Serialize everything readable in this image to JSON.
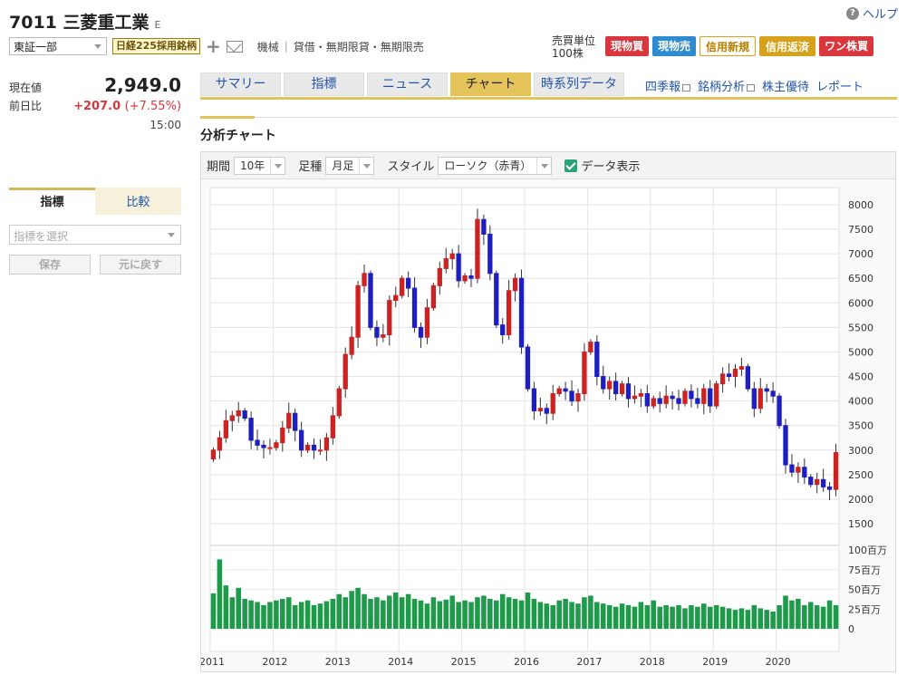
{
  "header": {
    "code_name": "7011 三菱重工業",
    "market_flag": "E",
    "help": "ヘルプ",
    "market_select": "東証一部",
    "nikkei_badge": "日経225採用銘柄",
    "industry": "機械",
    "margin_info": "貸借・無期限貸・無期限売",
    "unit_label": "売買単位",
    "unit_value": "100株"
  },
  "trade_buttons": [
    "現物買",
    "現物売",
    "信用新規",
    "信用返済",
    "ワン株買"
  ],
  "quote": {
    "price_label": "現在値",
    "price": "2,949.0",
    "change_label": "前日比",
    "change": "+207.0",
    "change_pct": "(+7.55%)",
    "time": "15:00"
  },
  "side": {
    "tab_indicator": "指標",
    "tab_compare": "比較",
    "indicator_placeholder": "指標を選択",
    "save": "保存",
    "reset": "元に戻す"
  },
  "tabs": [
    "サマリー",
    "指標",
    "ニュース",
    "チャート",
    "時系列データ"
  ],
  "tab_links": [
    "四季報",
    "銘柄分析",
    "株主優待",
    "レポート"
  ],
  "section_title": "分析チャート",
  "controls": {
    "period_label": "期間",
    "period_value": "10年",
    "bar_label": "足種",
    "bar_value": "月足",
    "style_label": "スタイル",
    "style_value": "ローソク（赤青）",
    "data_label": "データ表示"
  },
  "colors": {
    "up": "#cc2222",
    "down": "#1f1fbf",
    "volume": "#1e9a4a",
    "accent": "#e4c45a"
  },
  "chart_data": {
    "type": "candlestick",
    "interval": "monthly",
    "price_ticks": [
      1500,
      2000,
      2500,
      3000,
      3500,
      4000,
      4500,
      5000,
      5500,
      6000,
      6500,
      7000,
      7500,
      8000
    ],
    "volume_ticks": [
      "0",
      "25百万",
      "50百万",
      "75百万",
      "100百万"
    ],
    "volume_ylim": [
      0,
      100
    ],
    "x_ticks": [
      "2011",
      "2012",
      "2013",
      "2014",
      "2015",
      "2016",
      "2017",
      "2018",
      "2019",
      "2020"
    ],
    "ylim": [
      1150,
      8350
    ],
    "series": [
      {
        "close_path": [
          [
            2011.0,
            3000
          ],
          [
            2011.1,
            3250
          ],
          [
            2011.2,
            3600
          ],
          [
            2011.3,
            3700
          ],
          [
            2011.4,
            3800
          ],
          [
            2011.5,
            3650
          ],
          [
            2011.6,
            3200
          ],
          [
            2011.7,
            3100
          ],
          [
            2011.8,
            3050
          ],
          [
            2011.9,
            3050
          ],
          [
            2012.0,
            3150
          ],
          [
            2012.1,
            3450
          ],
          [
            2012.2,
            3750
          ],
          [
            2012.3,
            3400
          ],
          [
            2012.4,
            3000
          ],
          [
            2012.5,
            3100
          ],
          [
            2012.6,
            3000
          ],
          [
            2012.7,
            3000
          ],
          [
            2012.8,
            3250
          ],
          [
            2012.9,
            3700
          ],
          [
            2013.0,
            4250
          ],
          [
            2013.1,
            4950
          ],
          [
            2013.2,
            5300
          ],
          [
            2013.3,
            6350
          ],
          [
            2013.4,
            6600
          ],
          [
            2013.5,
            5500
          ],
          [
            2013.6,
            5300
          ],
          [
            2013.7,
            5350
          ],
          [
            2013.8,
            6050
          ],
          [
            2013.9,
            6150
          ],
          [
            2014.0,
            6500
          ],
          [
            2014.1,
            6300
          ],
          [
            2014.2,
            5500
          ],
          [
            2014.3,
            5300
          ],
          [
            2014.4,
            5900
          ],
          [
            2014.5,
            6350
          ],
          [
            2014.6,
            6700
          ],
          [
            2014.7,
            6900
          ],
          [
            2014.8,
            7000
          ],
          [
            2014.9,
            6450
          ],
          [
            2015.0,
            6550
          ],
          [
            2015.1,
            6500
          ],
          [
            2015.2,
            7700
          ],
          [
            2015.3,
            7400
          ],
          [
            2015.4,
            6600
          ],
          [
            2015.5,
            5550
          ],
          [
            2015.6,
            5350
          ],
          [
            2015.7,
            6250
          ],
          [
            2015.8,
            6500
          ],
          [
            2015.9,
            5100
          ],
          [
            2016.0,
            4250
          ],
          [
            2016.1,
            3800
          ],
          [
            2016.2,
            3850
          ],
          [
            2016.3,
            3750
          ],
          [
            2016.4,
            4150
          ],
          [
            2016.5,
            4250
          ],
          [
            2016.6,
            4200
          ],
          [
            2016.7,
            4000
          ],
          [
            2016.8,
            4150
          ],
          [
            2016.9,
            5000
          ],
          [
            2017.0,
            5200
          ],
          [
            2017.1,
            4500
          ],
          [
            2017.2,
            4250
          ],
          [
            2017.3,
            4400
          ],
          [
            2017.4,
            4150
          ],
          [
            2017.5,
            4350
          ],
          [
            2017.6,
            4050
          ],
          [
            2017.7,
            4100
          ],
          [
            2017.8,
            4150
          ],
          [
            2017.9,
            3900
          ],
          [
            2018.0,
            4050
          ],
          [
            2018.1,
            3950
          ],
          [
            2018.2,
            4100
          ],
          [
            2018.3,
            4050
          ],
          [
            2018.4,
            3950
          ],
          [
            2018.5,
            4200
          ],
          [
            2018.6,
            4050
          ],
          [
            2018.7,
            3950
          ],
          [
            2018.8,
            4250
          ],
          [
            2018.9,
            3900
          ],
          [
            2019.0,
            4350
          ],
          [
            2019.1,
            4550
          ],
          [
            2019.2,
            4500
          ],
          [
            2019.3,
            4650
          ],
          [
            2019.4,
            4700
          ],
          [
            2019.5,
            4250
          ],
          [
            2019.6,
            3850
          ],
          [
            2019.7,
            4250
          ],
          [
            2019.8,
            4200
          ],
          [
            2019.9,
            4100
          ],
          [
            2020.0,
            3500
          ],
          [
            2020.1,
            2700
          ],
          [
            2020.2,
            2550
          ],
          [
            2020.3,
            2650
          ],
          [
            2020.4,
            2450
          ],
          [
            2020.5,
            2300
          ],
          [
            2020.6,
            2400
          ],
          [
            2020.7,
            2250
          ],
          [
            2020.8,
            2200
          ],
          [
            2020.9,
            2949
          ]
        ],
        "volume_path": [
          [
            2011.0,
            45
          ],
          [
            2011.1,
            88
          ],
          [
            2011.2,
            55
          ],
          [
            2011.3,
            40
          ],
          [
            2011.4,
            52
          ],
          [
            2011.5,
            38
          ],
          [
            2011.6,
            36
          ],
          [
            2011.7,
            34
          ],
          [
            2011.8,
            30
          ],
          [
            2011.9,
            34
          ],
          [
            2012.0,
            36
          ],
          [
            2012.1,
            38
          ],
          [
            2012.2,
            40
          ],
          [
            2012.3,
            30
          ],
          [
            2012.4,
            34
          ],
          [
            2012.5,
            36
          ],
          [
            2012.6,
            30
          ],
          [
            2012.7,
            32
          ],
          [
            2012.8,
            35
          ],
          [
            2012.9,
            38
          ],
          [
            2013.0,
            44
          ],
          [
            2013.1,
            40
          ],
          [
            2013.2,
            48
          ],
          [
            2013.3,
            52
          ],
          [
            2013.4,
            44
          ],
          [
            2013.5,
            38
          ],
          [
            2013.6,
            40
          ],
          [
            2013.7,
            36
          ],
          [
            2013.8,
            42
          ],
          [
            2013.9,
            46
          ],
          [
            2014.0,
            40
          ],
          [
            2014.1,
            44
          ],
          [
            2014.2,
            38
          ],
          [
            2014.3,
            36
          ],
          [
            2014.4,
            32
          ],
          [
            2014.5,
            40
          ],
          [
            2014.6,
            35
          ],
          [
            2014.7,
            37
          ],
          [
            2014.8,
            42
          ],
          [
            2014.9,
            34
          ],
          [
            2015.0,
            36
          ],
          [
            2015.1,
            34
          ],
          [
            2015.2,
            40
          ],
          [
            2015.3,
            42
          ],
          [
            2015.4,
            38
          ],
          [
            2015.5,
            36
          ],
          [
            2015.6,
            44
          ],
          [
            2015.7,
            40
          ],
          [
            2015.8,
            38
          ],
          [
            2015.9,
            36
          ],
          [
            2016.0,
            46
          ],
          [
            2016.1,
            38
          ],
          [
            2016.2,
            34
          ],
          [
            2016.3,
            32
          ],
          [
            2016.4,
            30
          ],
          [
            2016.5,
            36
          ],
          [
            2016.6,
            38
          ],
          [
            2016.7,
            34
          ],
          [
            2016.8,
            32
          ],
          [
            2016.9,
            40
          ],
          [
            2017.0,
            42
          ],
          [
            2017.1,
            34
          ],
          [
            2017.2,
            32
          ],
          [
            2017.3,
            30
          ],
          [
            2017.4,
            28
          ],
          [
            2017.5,
            32
          ],
          [
            2017.6,
            30
          ],
          [
            2017.7,
            28
          ],
          [
            2017.8,
            34
          ],
          [
            2017.9,
            30
          ],
          [
            2018.0,
            36
          ],
          [
            2018.1,
            28
          ],
          [
            2018.2,
            30
          ],
          [
            2018.3,
            28
          ],
          [
            2018.4,
            30
          ],
          [
            2018.5,
            26
          ],
          [
            2018.6,
            30
          ],
          [
            2018.7,
            28
          ],
          [
            2018.8,
            32
          ],
          [
            2018.9,
            28
          ],
          [
            2019.0,
            30
          ],
          [
            2019.1,
            28
          ],
          [
            2019.2,
            26
          ],
          [
            2019.3,
            24
          ],
          [
            2019.4,
            26
          ],
          [
            2019.5,
            24
          ],
          [
            2019.6,
            30
          ],
          [
            2019.7,
            26
          ],
          [
            2019.8,
            24
          ],
          [
            2019.9,
            22
          ],
          [
            2020.0,
            30
          ],
          [
            2020.1,
            42
          ],
          [
            2020.2,
            36
          ],
          [
            2020.3,
            38
          ],
          [
            2020.4,
            30
          ],
          [
            2020.5,
            34
          ],
          [
            2020.6,
            30
          ],
          [
            2020.7,
            28
          ],
          [
            2020.8,
            36
          ],
          [
            2020.9,
            30
          ]
        ]
      }
    ]
  }
}
